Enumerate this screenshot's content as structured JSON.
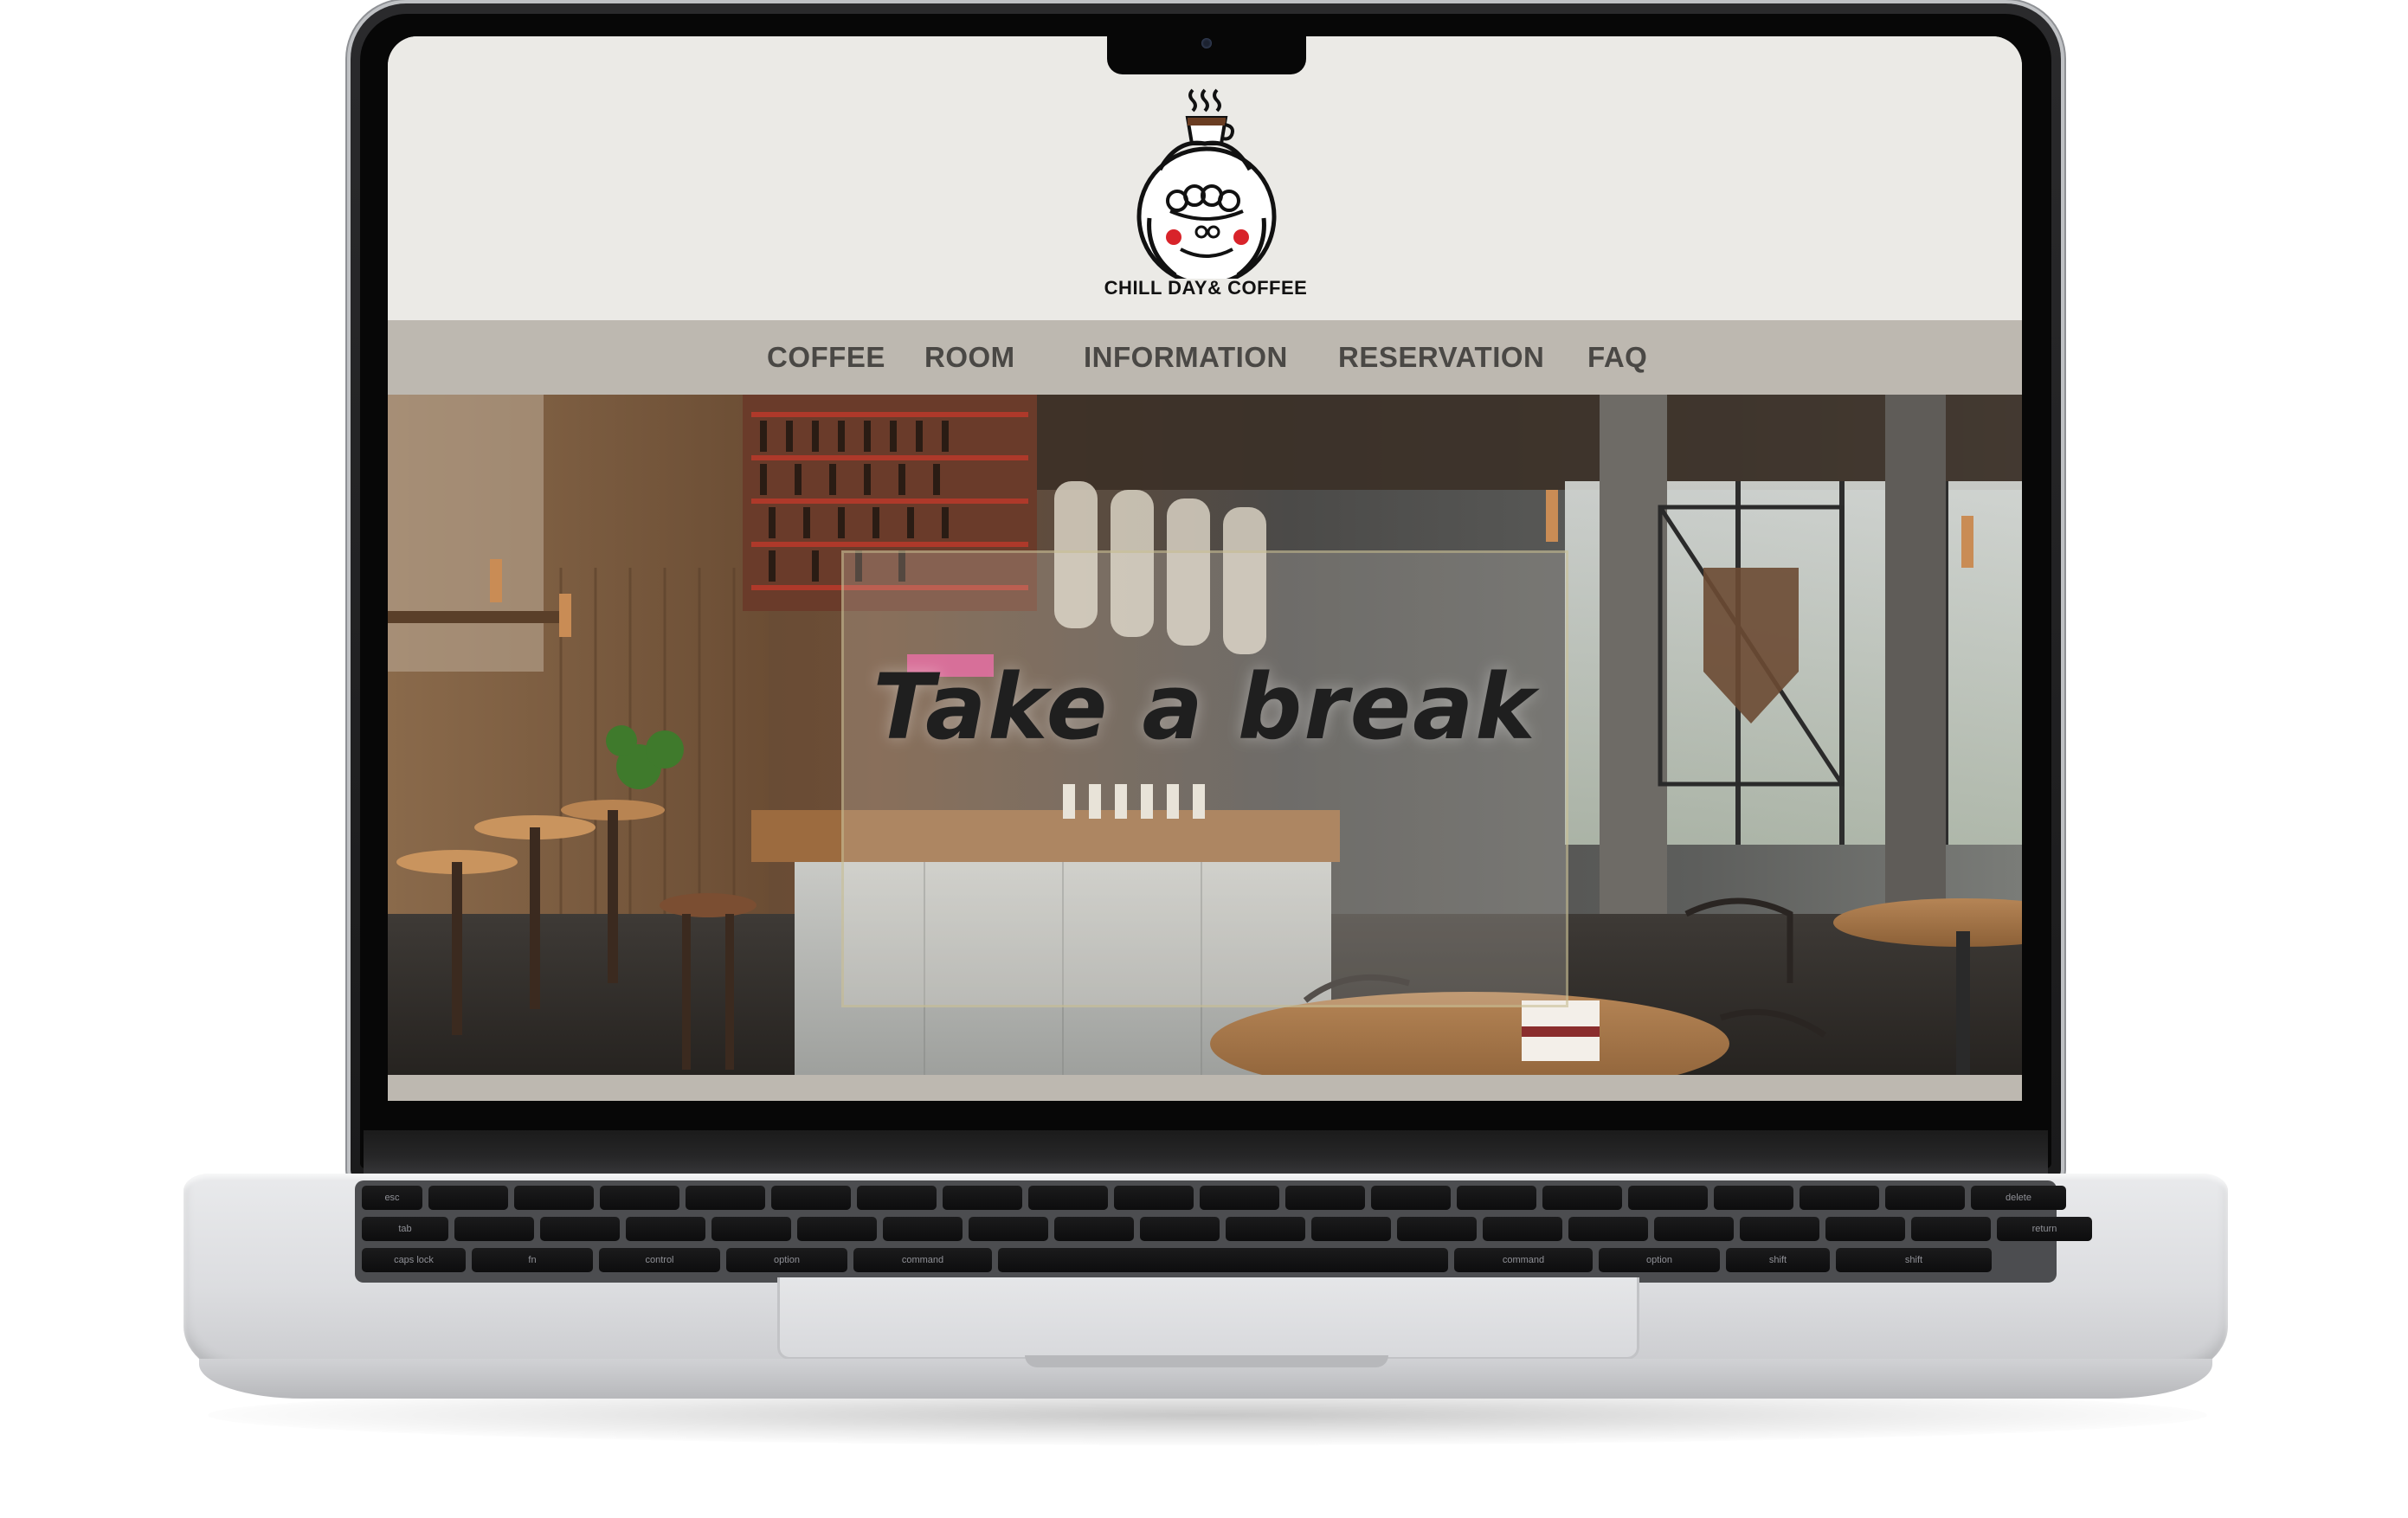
{
  "brand": {
    "logo_text": "CHILL DAY& COFFEE",
    "logo_icon": "coffee-character-logo"
  },
  "nav": {
    "items": [
      {
        "label": "COFFEE"
      },
      {
        "label": "ROOM"
      },
      {
        "label": "INFORMATION"
      },
      {
        "label": "RESERVATION"
      },
      {
        "label": "FAQ"
      }
    ]
  },
  "hero": {
    "tagline": "Take a break",
    "image": "cafe-interior-photo"
  },
  "keyboard": {
    "labels": [
      "esc",
      "tab",
      "caps lock",
      "shift",
      "fn",
      "control",
      "option",
      "command",
      "command",
      "option",
      "delete",
      "return",
      "shift"
    ]
  },
  "colors": {
    "header_bg": "#ebeae6",
    "nav_bg": "#bdb8b0",
    "nav_text": "#4a4845"
  }
}
